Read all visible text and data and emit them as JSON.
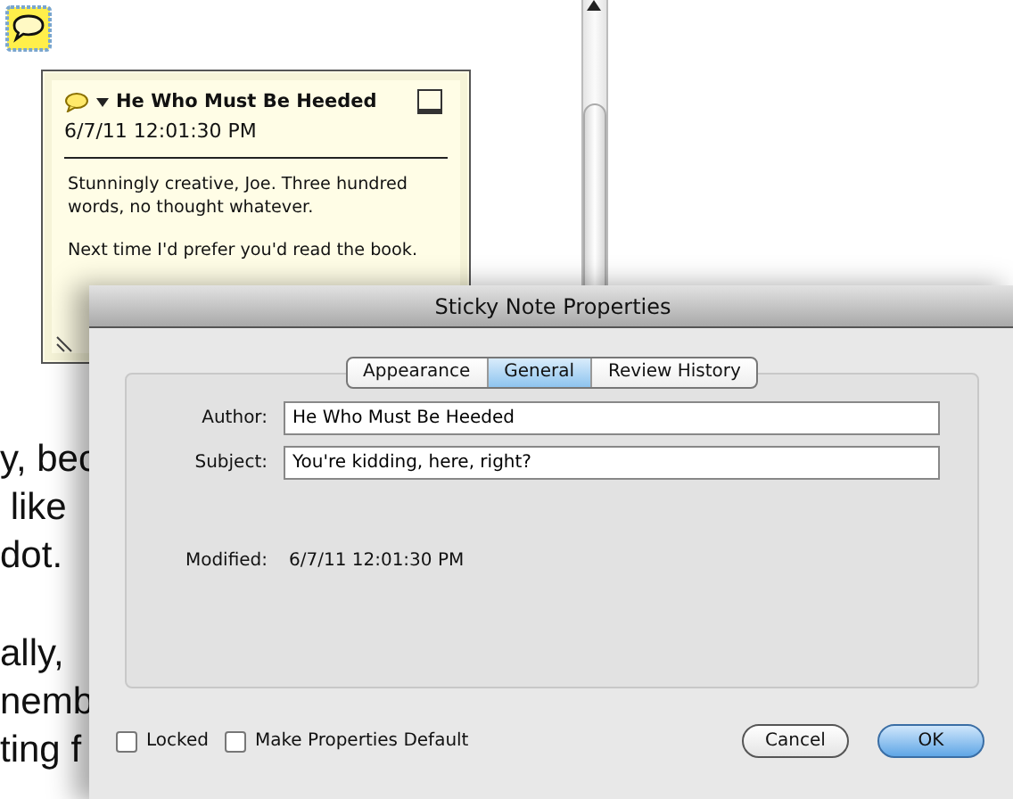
{
  "sticky_note": {
    "author": "He Who Must Be Heeded",
    "date": "6/7/11 12:01:30 PM",
    "paragraphs": [
      "Stunningly creative, Joe. Three hundred words, no thought whatever.",
      "Next time I'd prefer you'd read the book."
    ]
  },
  "document_text": [
    "y, bec",
    "like",
    "dot.",
    "ally,",
    "nemb",
    "ting f"
  ],
  "dialog": {
    "title": "Sticky Note Properties",
    "tabs": [
      {
        "label": "Appearance",
        "selected": false
      },
      {
        "label": "General",
        "selected": true
      },
      {
        "label": "Review History",
        "selected": false
      }
    ],
    "fields": [
      {
        "label": "Author:",
        "value": "He Who Must Be Heeded"
      },
      {
        "label": "Subject:",
        "value": "You're kidding, here, right?"
      }
    ],
    "modified": {
      "label": "Modified:",
      "value": "6/7/11 12:01:30 PM"
    },
    "checkboxes": [
      {
        "label": "Locked",
        "checked": false
      },
      {
        "label": "Make Properties Default",
        "checked": false
      }
    ],
    "buttons": [
      {
        "label": "Cancel",
        "default": false
      },
      {
        "label": "OK",
        "default": true
      }
    ]
  }
}
